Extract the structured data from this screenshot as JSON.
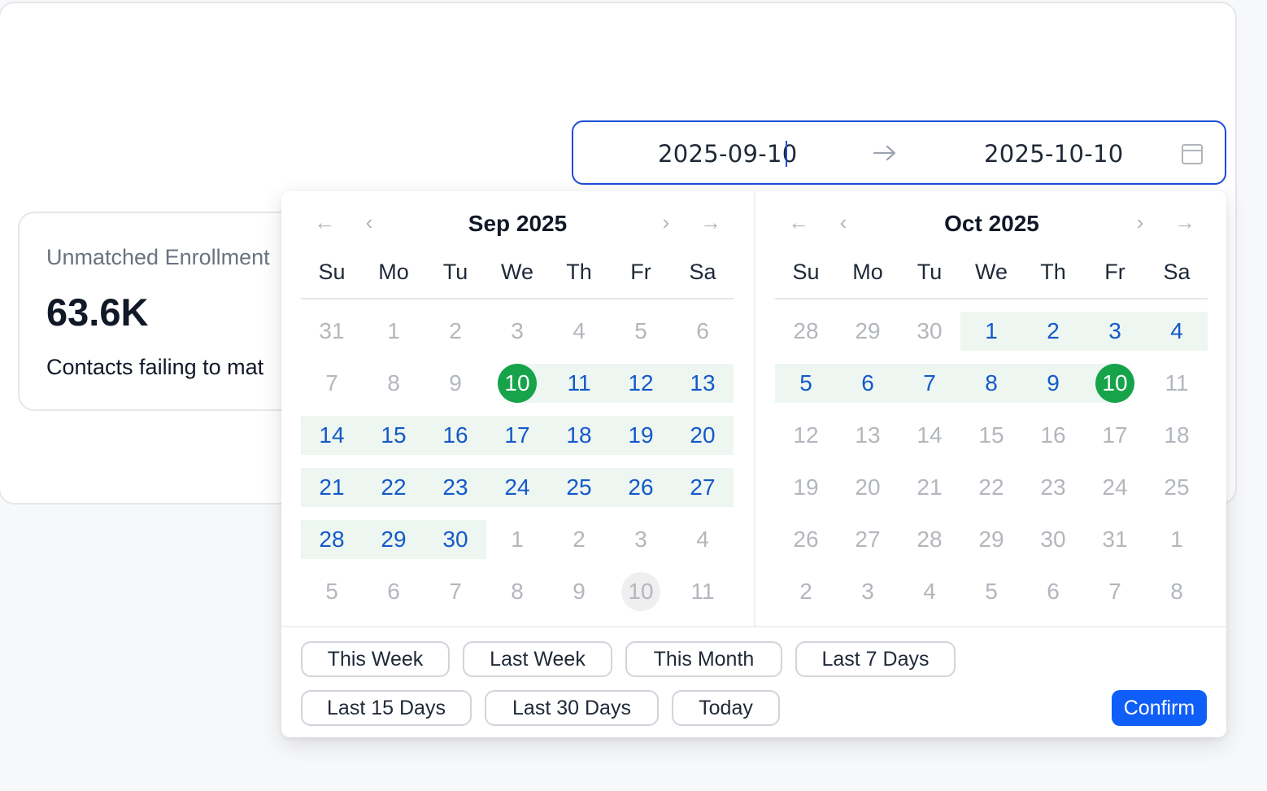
{
  "range": {
    "start_value": "2025-09-10",
    "end_value": "2025-10-10"
  },
  "stat_card": {
    "label": "Unmatched Enrollment",
    "value": "63.6K",
    "description": "Contacts failing to mat"
  },
  "calendar": {
    "weekdays": [
      "Su",
      "Mo",
      "Tu",
      "We",
      "Th",
      "Fr",
      "Sa"
    ],
    "nav_icons": [
      "double-arrow-left-icon",
      "chevron-left-icon",
      "chevron-right-icon",
      "double-arrow-right-icon"
    ],
    "left": {
      "title": "Sep 2025",
      "days": [
        {
          "d": "31",
          "s": "off"
        },
        {
          "d": "1",
          "s": "off"
        },
        {
          "d": "2",
          "s": "off"
        },
        {
          "d": "3",
          "s": "off"
        },
        {
          "d": "4",
          "s": "off"
        },
        {
          "d": "5",
          "s": "off"
        },
        {
          "d": "6",
          "s": "off"
        },
        {
          "d": "7",
          "s": "off"
        },
        {
          "d": "8",
          "s": "off"
        },
        {
          "d": "9",
          "s": "off"
        },
        {
          "d": "10",
          "s": "sel"
        },
        {
          "d": "11",
          "s": "in"
        },
        {
          "d": "12",
          "s": "in"
        },
        {
          "d": "13",
          "s": "in"
        },
        {
          "d": "14",
          "s": "in"
        },
        {
          "d": "15",
          "s": "in"
        },
        {
          "d": "16",
          "s": "in"
        },
        {
          "d": "17",
          "s": "in"
        },
        {
          "d": "18",
          "s": "in"
        },
        {
          "d": "19",
          "s": "in"
        },
        {
          "d": "20",
          "s": "in"
        },
        {
          "d": "21",
          "s": "in"
        },
        {
          "d": "22",
          "s": "in"
        },
        {
          "d": "23",
          "s": "in"
        },
        {
          "d": "24",
          "s": "in"
        },
        {
          "d": "25",
          "s": "in"
        },
        {
          "d": "26",
          "s": "in"
        },
        {
          "d": "27",
          "s": "in"
        },
        {
          "d": "28",
          "s": "in"
        },
        {
          "d": "29",
          "s": "in"
        },
        {
          "d": "30",
          "s": "in"
        },
        {
          "d": "1",
          "s": "off"
        },
        {
          "d": "2",
          "s": "off"
        },
        {
          "d": "3",
          "s": "off"
        },
        {
          "d": "4",
          "s": "off"
        },
        {
          "d": "5",
          "s": "off"
        },
        {
          "d": "6",
          "s": "off"
        },
        {
          "d": "7",
          "s": "off"
        },
        {
          "d": "8",
          "s": "off"
        },
        {
          "d": "9",
          "s": "off"
        },
        {
          "d": "10",
          "s": "today-muted"
        },
        {
          "d": "11",
          "s": "off"
        }
      ]
    },
    "right": {
      "title": "Oct 2025",
      "days": [
        {
          "d": "28",
          "s": "off"
        },
        {
          "d": "29",
          "s": "off"
        },
        {
          "d": "30",
          "s": "off"
        },
        {
          "d": "1",
          "s": "in"
        },
        {
          "d": "2",
          "s": "in"
        },
        {
          "d": "3",
          "s": "in"
        },
        {
          "d": "4",
          "s": "in"
        },
        {
          "d": "5",
          "s": "in"
        },
        {
          "d": "6",
          "s": "in"
        },
        {
          "d": "7",
          "s": "in"
        },
        {
          "d": "8",
          "s": "in"
        },
        {
          "d": "9",
          "s": "in"
        },
        {
          "d": "10",
          "s": "sel-today"
        },
        {
          "d": "11",
          "s": "off"
        },
        {
          "d": "12",
          "s": "off"
        },
        {
          "d": "13",
          "s": "off"
        },
        {
          "d": "14",
          "s": "off"
        },
        {
          "d": "15",
          "s": "off"
        },
        {
          "d": "16",
          "s": "off"
        },
        {
          "d": "17",
          "s": "off"
        },
        {
          "d": "18",
          "s": "off"
        },
        {
          "d": "19",
          "s": "off"
        },
        {
          "d": "20",
          "s": "off"
        },
        {
          "d": "21",
          "s": "off"
        },
        {
          "d": "22",
          "s": "off"
        },
        {
          "d": "23",
          "s": "off"
        },
        {
          "d": "24",
          "s": "off"
        },
        {
          "d": "25",
          "s": "off"
        },
        {
          "d": "26",
          "s": "off"
        },
        {
          "d": "27",
          "s": "off"
        },
        {
          "d": "28",
          "s": "off"
        },
        {
          "d": "29",
          "s": "off"
        },
        {
          "d": "30",
          "s": "off"
        },
        {
          "d": "31",
          "s": "off"
        },
        {
          "d": "1",
          "s": "off"
        },
        {
          "d": "2",
          "s": "off"
        },
        {
          "d": "3",
          "s": "off"
        },
        {
          "d": "4",
          "s": "off"
        },
        {
          "d": "5",
          "s": "off"
        },
        {
          "d": "6",
          "s": "off"
        },
        {
          "d": "7",
          "s": "off"
        },
        {
          "d": "8",
          "s": "off"
        }
      ]
    }
  },
  "presets": {
    "this_week": "This Week",
    "last_week": "Last Week",
    "this_month": "This Month",
    "last_7": "Last 7 Days",
    "last_15": "Last 15 Days",
    "last_30": "Last 30 Days",
    "today": "Today"
  },
  "confirm_label": "Confirm",
  "colors": {
    "accent": "#0f5ef7",
    "selected": "#16a34a",
    "in_range_bg": "#edf6f1",
    "in_range_text": "#1459c9"
  }
}
